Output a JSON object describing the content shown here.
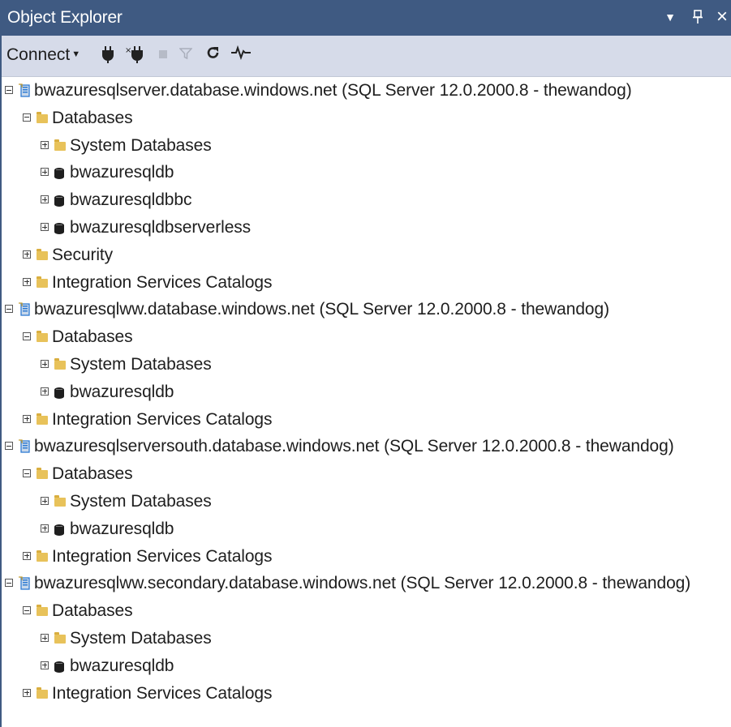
{
  "window": {
    "title": "Object Explorer",
    "buttons": {
      "dropdown": "▾",
      "pin": "ᵖ",
      "close": "×"
    }
  },
  "toolbar": {
    "connect_label": "Connect",
    "connect_caret": "▾"
  },
  "tree": {
    "servers": [
      {
        "label": "bwazuresqlserver.database.windows.net (SQL Server 12.0.2000.8 - thewandog)",
        "children": [
          {
            "label": "Databases",
            "children": [
              {
                "label": "System Databases",
                "type": "folder"
              },
              {
                "label": "bwazuresqldb",
                "type": "database"
              },
              {
                "label": "bwazuresqldbbc",
                "type": "database"
              },
              {
                "label": "bwazuresqldbserverless",
                "type": "database"
              }
            ]
          },
          {
            "label": "Security",
            "type": "folder"
          },
          {
            "label": "Integration Services Catalogs",
            "type": "folder"
          }
        ]
      },
      {
        "label": "bwazuresqlww.database.windows.net (SQL Server 12.0.2000.8 - thewandog)",
        "children": [
          {
            "label": "Databases",
            "children": [
              {
                "label": "System Databases",
                "type": "folder"
              },
              {
                "label": "bwazuresqldb",
                "type": "database"
              }
            ]
          },
          {
            "label": "Integration Services Catalogs",
            "type": "folder"
          }
        ]
      },
      {
        "label": "bwazuresqlserversouth.database.windows.net (SQL Server 12.0.2000.8 - thewandog)",
        "children": [
          {
            "label": "Databases",
            "children": [
              {
                "label": "System Databases",
                "type": "folder"
              },
              {
                "label": "bwazuresqldb",
                "type": "database"
              }
            ]
          },
          {
            "label": "Integration Services Catalogs",
            "type": "folder"
          }
        ]
      },
      {
        "label": "bwazuresqlww.secondary.database.windows.net (SQL Server 12.0.2000.8 - thewandog)",
        "children": [
          {
            "label": "Databases",
            "children": [
              {
                "label": "System Databases",
                "type": "folder"
              },
              {
                "label": "bwazuresqldb",
                "type": "database"
              }
            ]
          },
          {
            "label": "Integration Services Catalogs",
            "type": "folder"
          }
        ]
      }
    ]
  },
  "colors": {
    "titlebar": "#3f5a82",
    "toolbar": "#d6dbe9",
    "folder": "#e8c25a",
    "database": "#1e1e1e",
    "server_accent": "#2e7bd3"
  }
}
